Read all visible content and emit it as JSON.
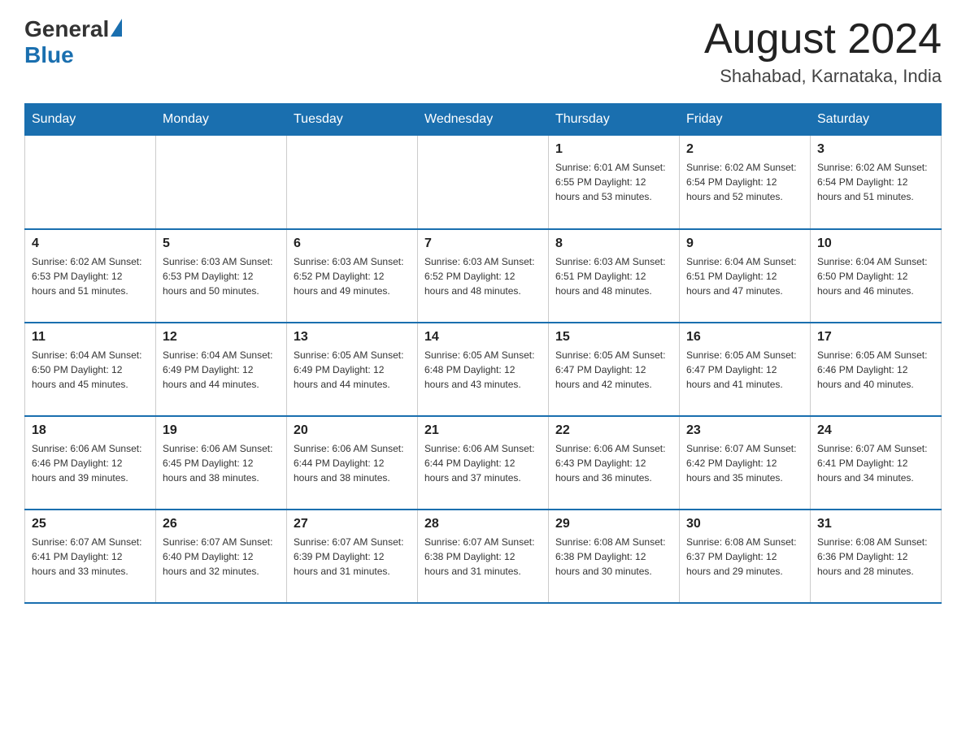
{
  "logo": {
    "general": "General",
    "blue": "Blue"
  },
  "header": {
    "month_year": "August 2024",
    "location": "Shahabad, Karnataka, India"
  },
  "days_of_week": [
    "Sunday",
    "Monday",
    "Tuesday",
    "Wednesday",
    "Thursday",
    "Friday",
    "Saturday"
  ],
  "weeks": [
    [
      {
        "day": "",
        "info": ""
      },
      {
        "day": "",
        "info": ""
      },
      {
        "day": "",
        "info": ""
      },
      {
        "day": "",
        "info": ""
      },
      {
        "day": "1",
        "info": "Sunrise: 6:01 AM\nSunset: 6:55 PM\nDaylight: 12 hours and 53 minutes."
      },
      {
        "day": "2",
        "info": "Sunrise: 6:02 AM\nSunset: 6:54 PM\nDaylight: 12 hours and 52 minutes."
      },
      {
        "day": "3",
        "info": "Sunrise: 6:02 AM\nSunset: 6:54 PM\nDaylight: 12 hours and 51 minutes."
      }
    ],
    [
      {
        "day": "4",
        "info": "Sunrise: 6:02 AM\nSunset: 6:53 PM\nDaylight: 12 hours and 51 minutes."
      },
      {
        "day": "5",
        "info": "Sunrise: 6:03 AM\nSunset: 6:53 PM\nDaylight: 12 hours and 50 minutes."
      },
      {
        "day": "6",
        "info": "Sunrise: 6:03 AM\nSunset: 6:52 PM\nDaylight: 12 hours and 49 minutes."
      },
      {
        "day": "7",
        "info": "Sunrise: 6:03 AM\nSunset: 6:52 PM\nDaylight: 12 hours and 48 minutes."
      },
      {
        "day": "8",
        "info": "Sunrise: 6:03 AM\nSunset: 6:51 PM\nDaylight: 12 hours and 48 minutes."
      },
      {
        "day": "9",
        "info": "Sunrise: 6:04 AM\nSunset: 6:51 PM\nDaylight: 12 hours and 47 minutes."
      },
      {
        "day": "10",
        "info": "Sunrise: 6:04 AM\nSunset: 6:50 PM\nDaylight: 12 hours and 46 minutes."
      }
    ],
    [
      {
        "day": "11",
        "info": "Sunrise: 6:04 AM\nSunset: 6:50 PM\nDaylight: 12 hours and 45 minutes."
      },
      {
        "day": "12",
        "info": "Sunrise: 6:04 AM\nSunset: 6:49 PM\nDaylight: 12 hours and 44 minutes."
      },
      {
        "day": "13",
        "info": "Sunrise: 6:05 AM\nSunset: 6:49 PM\nDaylight: 12 hours and 44 minutes."
      },
      {
        "day": "14",
        "info": "Sunrise: 6:05 AM\nSunset: 6:48 PM\nDaylight: 12 hours and 43 minutes."
      },
      {
        "day": "15",
        "info": "Sunrise: 6:05 AM\nSunset: 6:47 PM\nDaylight: 12 hours and 42 minutes."
      },
      {
        "day": "16",
        "info": "Sunrise: 6:05 AM\nSunset: 6:47 PM\nDaylight: 12 hours and 41 minutes."
      },
      {
        "day": "17",
        "info": "Sunrise: 6:05 AM\nSunset: 6:46 PM\nDaylight: 12 hours and 40 minutes."
      }
    ],
    [
      {
        "day": "18",
        "info": "Sunrise: 6:06 AM\nSunset: 6:46 PM\nDaylight: 12 hours and 39 minutes."
      },
      {
        "day": "19",
        "info": "Sunrise: 6:06 AM\nSunset: 6:45 PM\nDaylight: 12 hours and 38 minutes."
      },
      {
        "day": "20",
        "info": "Sunrise: 6:06 AM\nSunset: 6:44 PM\nDaylight: 12 hours and 38 minutes."
      },
      {
        "day": "21",
        "info": "Sunrise: 6:06 AM\nSunset: 6:44 PM\nDaylight: 12 hours and 37 minutes."
      },
      {
        "day": "22",
        "info": "Sunrise: 6:06 AM\nSunset: 6:43 PM\nDaylight: 12 hours and 36 minutes."
      },
      {
        "day": "23",
        "info": "Sunrise: 6:07 AM\nSunset: 6:42 PM\nDaylight: 12 hours and 35 minutes."
      },
      {
        "day": "24",
        "info": "Sunrise: 6:07 AM\nSunset: 6:41 PM\nDaylight: 12 hours and 34 minutes."
      }
    ],
    [
      {
        "day": "25",
        "info": "Sunrise: 6:07 AM\nSunset: 6:41 PM\nDaylight: 12 hours and 33 minutes."
      },
      {
        "day": "26",
        "info": "Sunrise: 6:07 AM\nSunset: 6:40 PM\nDaylight: 12 hours and 32 minutes."
      },
      {
        "day": "27",
        "info": "Sunrise: 6:07 AM\nSunset: 6:39 PM\nDaylight: 12 hours and 31 minutes."
      },
      {
        "day": "28",
        "info": "Sunrise: 6:07 AM\nSunset: 6:38 PM\nDaylight: 12 hours and 31 minutes."
      },
      {
        "day": "29",
        "info": "Sunrise: 6:08 AM\nSunset: 6:38 PM\nDaylight: 12 hours and 30 minutes."
      },
      {
        "day": "30",
        "info": "Sunrise: 6:08 AM\nSunset: 6:37 PM\nDaylight: 12 hours and 29 minutes."
      },
      {
        "day": "31",
        "info": "Sunrise: 6:08 AM\nSunset: 6:36 PM\nDaylight: 12 hours and 28 minutes."
      }
    ]
  ]
}
